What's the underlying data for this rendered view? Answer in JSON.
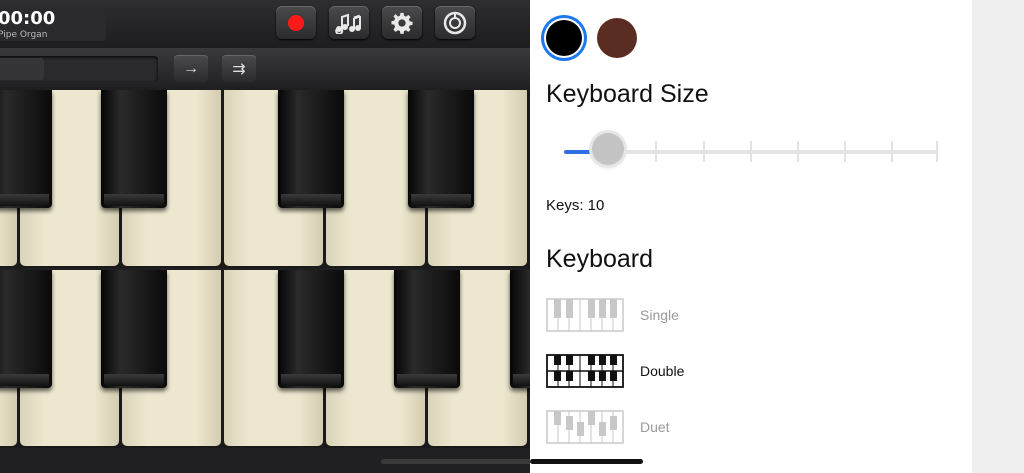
{
  "toolbar": {
    "time": "00:00",
    "instrument": "Pipe Organ",
    "record_icon": "record-icon",
    "notes_icon": "music-notes-icon",
    "settings_icon": "gear-icon",
    "loop_icon": "loop-icon",
    "arrow_icon": "→",
    "double_arrow_icon": "⇉"
  },
  "settings": {
    "colors": [
      {
        "hex": "#000000",
        "selected": true
      },
      {
        "hex": "#5b2d22",
        "selected": false
      }
    ],
    "keyboard_size_title": "Keyboard Size",
    "slider": {
      "value": 0,
      "steps": 9
    },
    "keys_label": "Keys: 10",
    "keyboard_title": "Keyboard",
    "keyboard_options": [
      {
        "label": "Single",
        "selected": false
      },
      {
        "label": "Double",
        "selected": true
      },
      {
        "label": "Duet",
        "selected": false
      }
    ]
  },
  "accent_color": "#2f6fe4"
}
